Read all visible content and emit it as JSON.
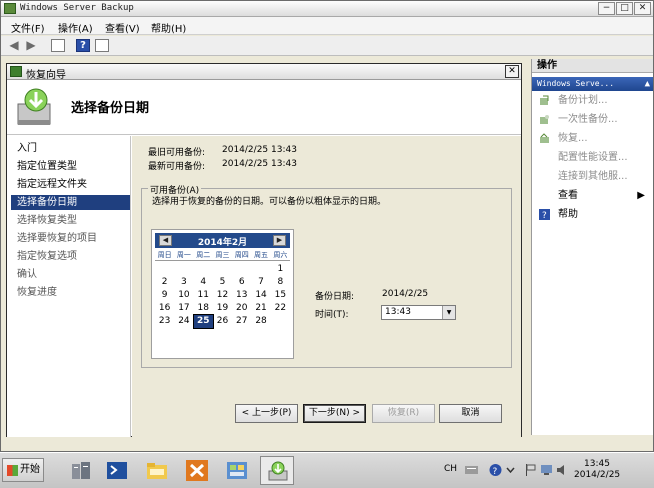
{
  "window": {
    "title": "Windows Server Backup",
    "controls": {
      "minimize": "−",
      "maximize": "□",
      "close": "✕"
    }
  },
  "menu": [
    "文件(F)",
    "操作(A)",
    "查看(V)",
    "帮助(H)"
  ],
  "actions_pane": {
    "header": "操作",
    "section": "Windows Serve...",
    "items": [
      {
        "label": "备份计划...",
        "enabled": false
      },
      {
        "label": "一次性备份...",
        "enabled": false
      },
      {
        "label": "恢复...",
        "enabled": false
      },
      {
        "label": "配置性能设置...",
        "enabled": false
      },
      {
        "label": "连接到其他服...",
        "enabled": false
      },
      {
        "label": "查看",
        "enabled": true,
        "submenu": "▶"
      },
      {
        "label": "帮助",
        "enabled": true
      }
    ]
  },
  "wizard": {
    "title": "恢复向导",
    "close": "✕",
    "heading": "选择备份日期",
    "steps": [
      {
        "label": "入门",
        "state": "done"
      },
      {
        "label": "指定位置类型",
        "state": "done"
      },
      {
        "label": "指定远程文件夹",
        "state": "done"
      },
      {
        "label": "选择备份日期",
        "state": "active"
      },
      {
        "label": "选择恢复类型",
        "state": "pending"
      },
      {
        "label": "选择要恢复的项目",
        "state": "pending"
      },
      {
        "label": "指定恢复选项",
        "state": "pending"
      },
      {
        "label": "确认",
        "state": "pending"
      },
      {
        "label": "恢复进度",
        "state": "pending"
      }
    ],
    "oldest_label": "最旧可用备份:",
    "oldest_value": "2014/2/25 13:43",
    "newest_label": "最新可用备份:",
    "newest_value": "2014/2/25 13:43",
    "group_label": "可用备份(A)",
    "group_desc": "选择用于恢复的备份的日期。可以备份以粗体显示的日期。",
    "calendar": {
      "month": "2014年2月",
      "prev": "◀",
      "next": "▶",
      "weekdays": [
        "周日",
        "周一",
        "周二",
        "周三",
        "周四",
        "周五",
        "周六"
      ],
      "weeks": [
        [
          "",
          "",
          "",
          "",
          "",
          "",
          "1"
        ],
        [
          "2",
          "3",
          "4",
          "5",
          "6",
          "7",
          "8"
        ],
        [
          "9",
          "10",
          "11",
          "12",
          "13",
          "14",
          "15"
        ],
        [
          "16",
          "17",
          "18",
          "19",
          "20",
          "21",
          "22"
        ],
        [
          "23",
          "24",
          "25",
          "26",
          "27",
          "28",
          ""
        ]
      ],
      "selected": "25"
    },
    "backup_date_label": "备份日期:",
    "backup_date_value": "2014/2/25",
    "time_label": "时间(T):",
    "time_value": "13:43",
    "buttons": {
      "back": "< 上一步(P)",
      "next": "下一步(N) >",
      "recover": "恢复(R)",
      "cancel": "取消"
    }
  },
  "taskbar": {
    "start": "开始",
    "lang": "CH",
    "time": "13:45",
    "date": "2014/2/25"
  },
  "colors": {
    "selection": "#1f3f7f",
    "calendar_header": "#234a8b",
    "actions_section": "#2b56a6"
  }
}
